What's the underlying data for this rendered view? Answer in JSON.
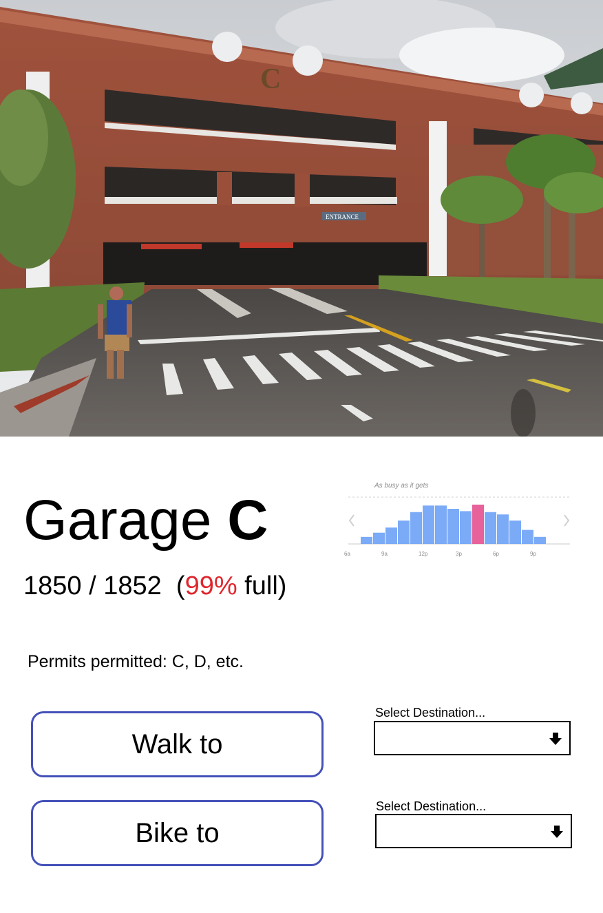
{
  "garage": {
    "name_prefix": "Garage ",
    "name_letter": "C",
    "occupied": "1850",
    "separator": " / ",
    "capacity": "1852",
    "open_paren": "  (",
    "percent_full_text": "99%",
    "percent_full_value": 0.99,
    "full_suffix": " full)",
    "permits": "Permits permitted: C, D, etc."
  },
  "photo": {
    "sign_letter": "C",
    "entrance_sign": "ENTRANCE"
  },
  "actions": {
    "walk_label": "Walk to",
    "bike_label": "Bike to"
  },
  "destinations": {
    "walk_label": "Select Destination...",
    "walk_value": "",
    "bike_label": "Select Destination...",
    "bike_value": ""
  },
  "colors": {
    "accent_border": "#4451b9",
    "percent_red": "#e0262d",
    "bar_blue": "#7baaf7",
    "bar_current": "#e7629a"
  },
  "chart_data": {
    "type": "bar",
    "title": "As busy as it gets",
    "hours": [
      "6a",
      "7a",
      "8a",
      "9a",
      "10a",
      "11a",
      "12p",
      "1p",
      "2p",
      "3p",
      "4p",
      "5p",
      "6p",
      "7p",
      "8p",
      "9p",
      "10p"
    ],
    "tick_labels": [
      "6a",
      "9a",
      "12p",
      "3p",
      "6p",
      "9p"
    ],
    "tick_indices": [
      0,
      3,
      6,
      9,
      12,
      15
    ],
    "values": [
      0.15,
      0.24,
      0.35,
      0.5,
      0.68,
      0.82,
      0.82,
      0.75,
      0.7,
      0.68,
      0.68,
      0.63,
      0.5,
      0.3,
      0.15,
      0,
      0
    ],
    "current_index": 9,
    "current_value": 0.84,
    "ylim": [
      0,
      1
    ],
    "grid": false
  }
}
